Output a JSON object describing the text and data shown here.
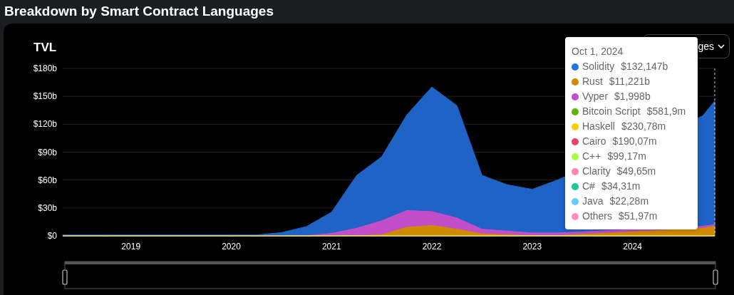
{
  "title": "Breakdown by Smart Contract Languages",
  "chart": {
    "dropdown": {
      "value": "ges"
    },
    "chart_data": {
      "type": "area",
      "stacked": true,
      "grid": true,
      "ylabel": "TVL",
      "x": [
        2018.32,
        2018.75,
        2019.0,
        2019.25,
        2019.5,
        2019.75,
        2020.0,
        2020.25,
        2020.5,
        2020.75,
        2021.0,
        2021.25,
        2021.5,
        2021.75,
        2022.0,
        2022.25,
        2022.5,
        2022.75,
        2023.0,
        2023.25,
        2024.7,
        2024.82
      ],
      "series": [
        {
          "color": "#d08a00",
          "values": [
            0,
            0,
            0,
            0,
            0,
            0,
            0,
            0,
            0,
            0,
            0.5,
            1,
            2,
            10,
            12,
            8,
            3,
            2,
            1,
            1,
            9,
            11
          ]
        },
        {
          "color": "#c24fc9",
          "values": [
            0,
            0,
            0,
            0,
            0,
            0,
            0,
            0,
            0.5,
            1,
            3,
            8,
            15,
            18,
            15,
            12,
            5,
            4,
            3,
            3,
            2,
            2
          ]
        },
        {
          "color": "#1f63c6",
          "values": [
            1,
            1,
            1,
            1,
            1,
            1,
            1,
            1,
            3,
            9,
            22,
            56,
            68,
            102,
            133,
            120,
            57,
            49,
            46,
            56,
            118,
            132
          ]
        }
      ],
      "xlim": [
        2018.32,
        2024.82
      ],
      "ylim": [
        0,
        180
      ],
      "xticks": [
        {
          "value": 2019,
          "label": "2019"
        },
        {
          "value": 2020,
          "label": "2020"
        },
        {
          "value": 2021,
          "label": "2021"
        },
        {
          "value": 2022,
          "label": "2022"
        },
        {
          "value": 2023,
          "label": "2023"
        },
        {
          "value": 2024,
          "label": "2024"
        }
      ],
      "yticks": [
        {
          "value": 0,
          "label": "$0"
        },
        {
          "value": 30,
          "label": "$30b"
        },
        {
          "value": 60,
          "label": "$60b"
        },
        {
          "value": 90,
          "label": "$90b"
        },
        {
          "value": 120,
          "label": "$120b"
        },
        {
          "value": 150,
          "label": "$150b"
        },
        {
          "value": 180,
          "label": "$180b"
        }
      ]
    },
    "tooltip": {
      "date": "Oct 1, 2024",
      "items": [
        {
          "name": "Solidity",
          "value": "$132,147b",
          "color": "#2172e5"
        },
        {
          "name": "Rust",
          "value": "$11,221b",
          "color": "#d08a00"
        },
        {
          "name": "Vyper",
          "value": "$1,998b",
          "color": "#c24fc9"
        },
        {
          "name": "Bitcoin Script",
          "value": "$581,9m",
          "color": "#5fb20a"
        },
        {
          "name": "Haskell",
          "value": "$230,78m",
          "color": "#ffcc00"
        },
        {
          "name": "Cairo",
          "value": "$190,07m",
          "color": "#ee4466"
        },
        {
          "name": "C++",
          "value": "$99,17m",
          "color": "#aaff44"
        },
        {
          "name": "Clarity",
          "value": "$49,65m",
          "color": "#ff88aa"
        },
        {
          "name": "C#",
          "value": "$34,31m",
          "color": "#11cc99"
        },
        {
          "name": "Java",
          "value": "$22,28m",
          "color": "#66ccff"
        },
        {
          "name": "Others",
          "value": "$51,97m",
          "color": "#ff8fbf"
        }
      ]
    }
  }
}
